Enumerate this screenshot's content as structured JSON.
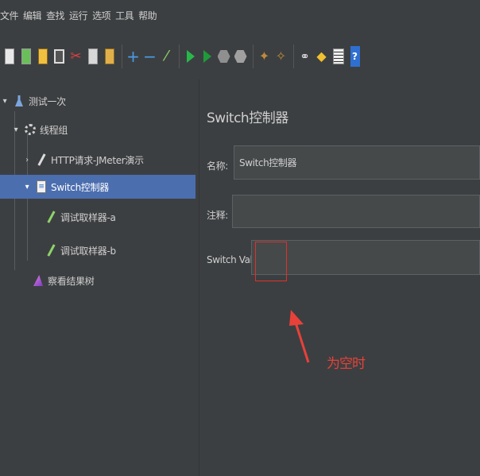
{
  "menu": [
    "文件",
    "编辑",
    "查找",
    "运行",
    "选项",
    "工具",
    "帮助"
  ],
  "toolbar": {
    "icons": [
      "new-icon",
      "templates-icon",
      "open-icon",
      "save-icon",
      "cut-icon",
      "copy-icon",
      "paste-icon",
      "expand-icon",
      "collapse-icon",
      "toggle-icon",
      "start-icon",
      "start-no-pause-icon",
      "stop-icon",
      "shutdown-icon",
      "clear-icon",
      "clear-all-icon",
      "search-icon",
      "reset-search-icon",
      "function-helper-icon",
      "help-icon"
    ],
    "plus": "+",
    "minus": "−",
    "toggle": "⁄",
    "help": "?"
  },
  "tree": {
    "test_plan": "测试一次",
    "thread_group": "线程组",
    "http_request": "HTTP请求-JMeter演示",
    "switch_controller": "Switch控制器",
    "sampler_a": "调试取样器-a",
    "sampler_b": "调试取样器-b",
    "result_tree": "察看结果树"
  },
  "panel": {
    "title": "Switch控制器",
    "name_label": "名称:",
    "name_value": "Switch控制器",
    "comment_label": "注释:",
    "comment_value": "",
    "switch_label": "Switch Value",
    "switch_value": ""
  },
  "annotation": {
    "text": "为空时",
    "color": "#e8413a"
  },
  "colors": {
    "selection": "#4b6eaf",
    "background": "#3c3f41"
  }
}
